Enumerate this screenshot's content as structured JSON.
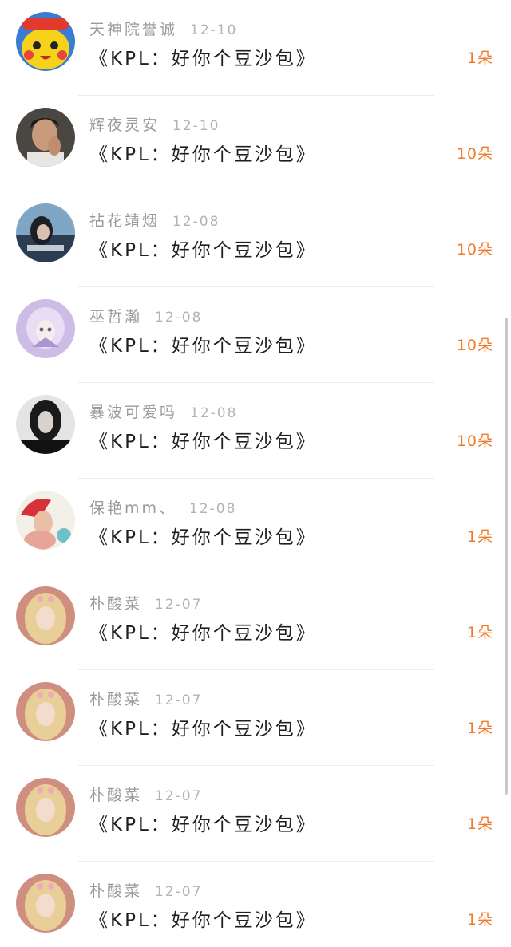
{
  "rows": [
    {
      "avatar_icon": "pikachu-hat-avatar-icon",
      "name": "天神院誉诚",
      "date": "12-10",
      "title": "《KPL：好你个豆沙包》",
      "count": "1朵"
    },
    {
      "avatar_icon": "man-portrait-avatar-icon",
      "name": "辉夜灵安",
      "date": "12-10",
      "title": "《KPL：好你个豆沙包》",
      "count": "10朵"
    },
    {
      "avatar_icon": "girl-blue-scene-avatar-icon",
      "name": "拈花靖烟",
      "date": "12-08",
      "title": "《KPL：好你个豆沙包》",
      "count": "10朵"
    },
    {
      "avatar_icon": "anime-girl-purple-avatar-icon",
      "name": "巫哲瀚",
      "date": "12-08",
      "title": "《KPL：好你个豆沙包》",
      "count": "10朵"
    },
    {
      "avatar_icon": "woman-bw-portrait-avatar-icon",
      "name": "暴波可爱吗",
      "date": "12-08",
      "title": "《KPL：好你个豆沙包》",
      "count": "10朵"
    },
    {
      "avatar_icon": "girl-red-hat-avatar-icon",
      "name": "保艳mm、",
      "date": "12-08",
      "title": "《KPL：好你个豆沙包》",
      "count": "1朵"
    },
    {
      "avatar_icon": "blonde-girl-avatar-icon",
      "name": "朴酸菜",
      "date": "12-07",
      "title": "《KPL：好你个豆沙包》",
      "count": "1朵"
    },
    {
      "avatar_icon": "blonde-girl-avatar-icon",
      "name": "朴酸菜",
      "date": "12-07",
      "title": "《KPL：好你个豆沙包》",
      "count": "1朵"
    },
    {
      "avatar_icon": "blonde-girl-avatar-icon",
      "name": "朴酸菜",
      "date": "12-07",
      "title": "《KPL：好你个豆沙包》",
      "count": "1朵"
    },
    {
      "avatar_icon": "blonde-girl-avatar-icon",
      "name": "朴酸菜",
      "date": "12-07",
      "title": "《KPL：好你个豆沙包》",
      "count": "1朵"
    }
  ],
  "colors": {
    "accent": "#f07a2a",
    "name_text": "#9a9a9a",
    "title_text": "#1e1e1e",
    "divider": "#ececec"
  }
}
